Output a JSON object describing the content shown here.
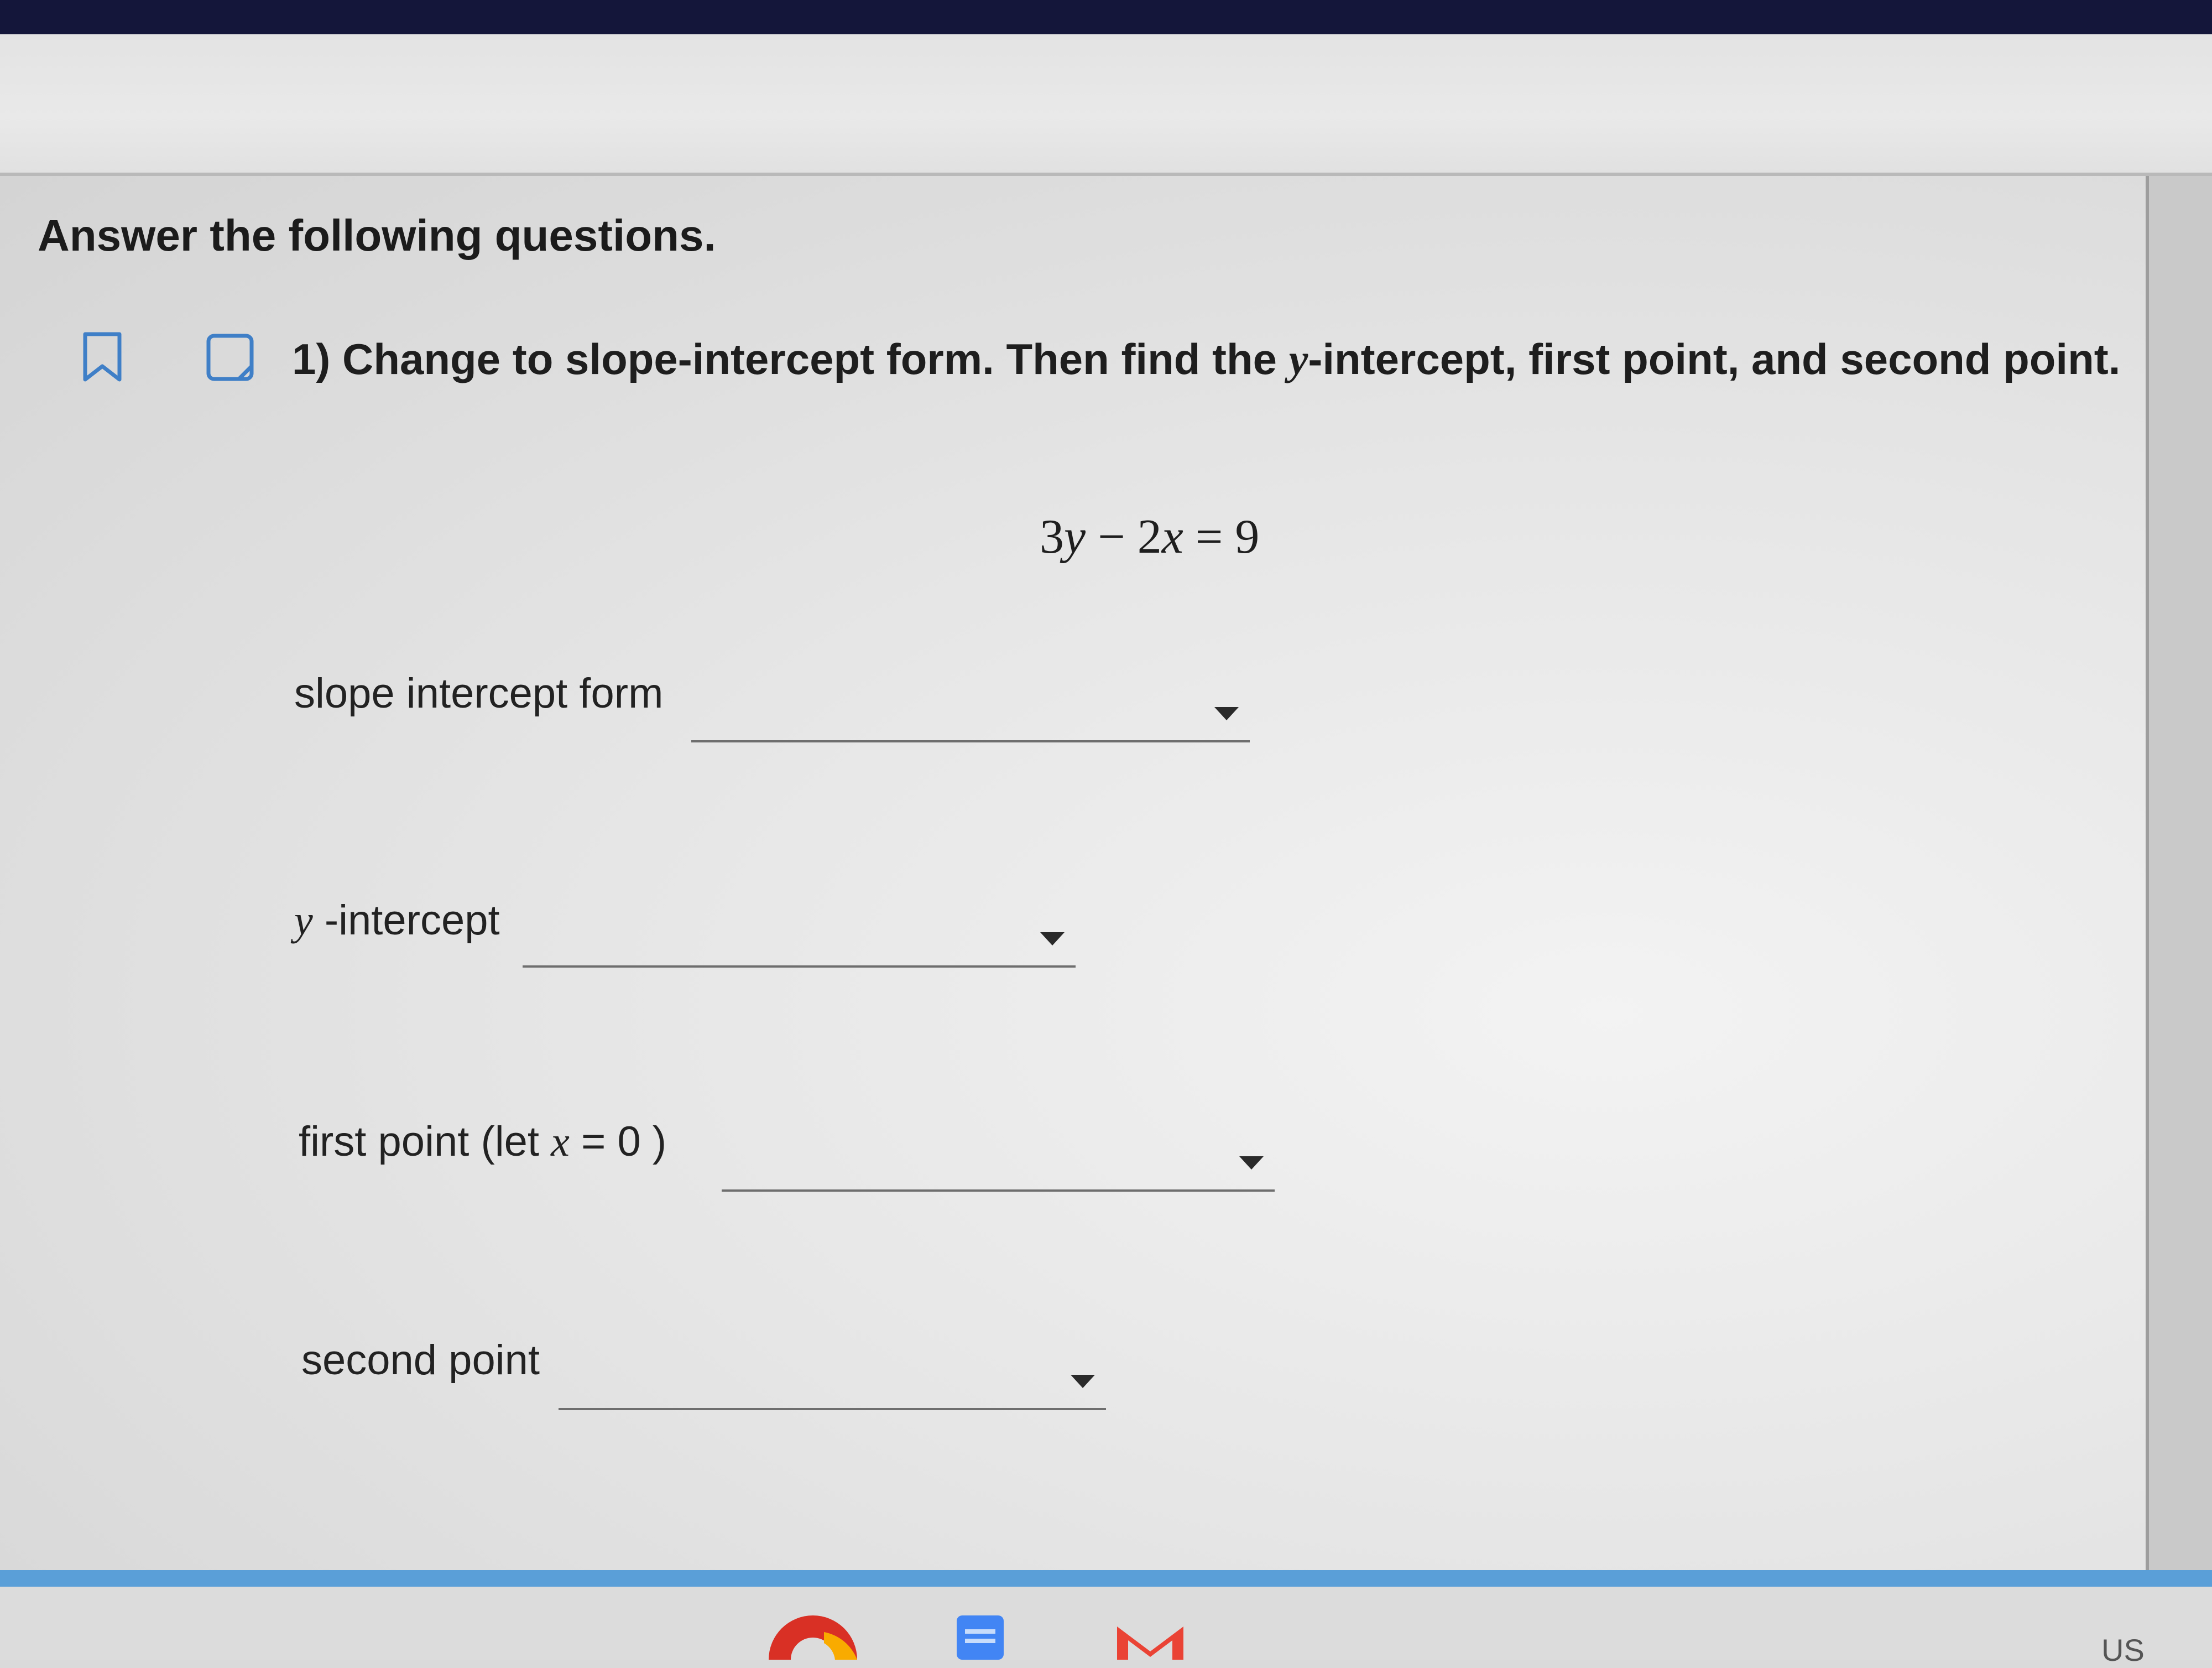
{
  "instructions": "Answer the following questions.",
  "question": {
    "title_before": "1) Change to slope-intercept form. Then find the ",
    "title_var": "y",
    "title_after": "-intercept, first point, and second point.",
    "equation": {
      "c1": "3",
      "v1": "y",
      "op1": " − ",
      "c2": "2",
      "v2": "x",
      "op2": " = ",
      "rhs": "9"
    }
  },
  "fields": {
    "slope": {
      "label": "slope intercept form",
      "value": ""
    },
    "yint": {
      "label_var": "y",
      "label_rest": " -intercept",
      "value": ""
    },
    "first": {
      "label_before": "first point (let ",
      "label_var": "x",
      "label_mid": " = 0 )",
      "value": ""
    },
    "second": {
      "label": "second point",
      "value": ""
    }
  },
  "taskbar": {
    "icons": [
      "chrome-icon",
      "docs-icon",
      "gmail-icon"
    ],
    "lang": "US"
  }
}
